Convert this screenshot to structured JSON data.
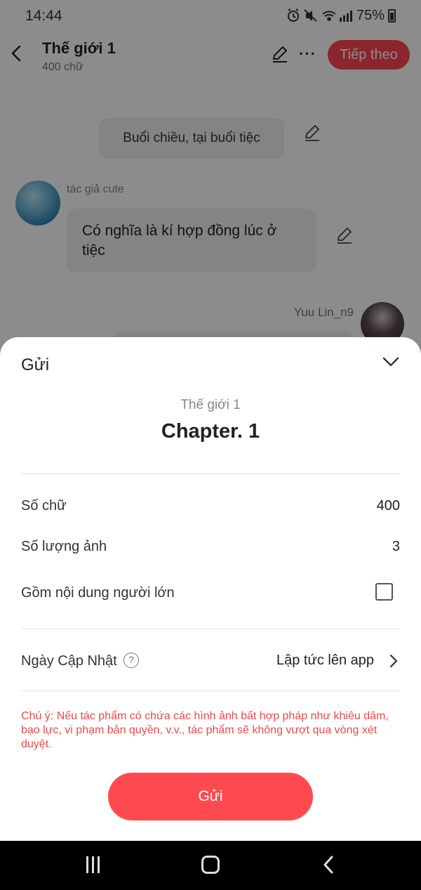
{
  "status_bar": {
    "time": "14:44",
    "icons": [
      "alarm-icon",
      "mute-icon",
      "wifi-icon",
      "signal-icon",
      "battery-icon"
    ],
    "battery": "75%"
  },
  "header": {
    "title": "Thế giới 1",
    "subtitle": "400 chữ",
    "next_label": "Tiếp theo"
  },
  "chat": {
    "narration": "Buổi chiều, tại buổi tiệc",
    "left_speaker": "tác giả cute",
    "left_message": "Có nghĩa là kí hợp đồng lúc ở tiệc",
    "right_speaker": "Yuu Lin_n9"
  },
  "sheet": {
    "title": "Gửi",
    "work_name": "Thế giới 1",
    "chapter": "Chapter. 1",
    "word_count_label": "Số chữ",
    "word_count_value": "400",
    "image_count_label": "Số lượng ảnh",
    "image_count_value": "3",
    "adult_label": "Gồm nội dung người lớn",
    "adult_checked": false,
    "update_label": "Ngày Cập Nhật",
    "help_glyph": "?",
    "update_value": "Lập tức lên app",
    "notice": "Chú ý: Nếu tác phẩm có chứa các hình ảnh bất hợp pháp như khiêu dâm, bạo lực, vi phạm bản quyền, v.v., tác phẩm sẽ không vượt qua vòng xét duyệt.",
    "submit_label": "Gửi"
  },
  "colors": {
    "accent": "#ff4a50",
    "notice": "#e84a4a"
  }
}
